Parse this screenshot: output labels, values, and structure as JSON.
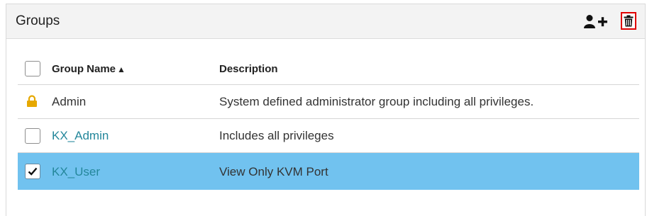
{
  "panel": {
    "title": "Groups",
    "toolbar": {
      "add_icon": "add-user-icon",
      "delete_icon": "trash-icon"
    }
  },
  "table": {
    "columns": {
      "name_header": "Group Name",
      "sort_indicator": "▲",
      "description_header": "Description"
    },
    "rows": [
      {
        "name": "Admin",
        "description": "System defined administrator group including all privileges.",
        "locked": true,
        "checked": false
      },
      {
        "name": "KX_Admin",
        "description": "Includes all privileges",
        "locked": false,
        "checked": false
      },
      {
        "name": "KX_User",
        "description": "View Only KVM Port",
        "locked": false,
        "checked": true
      }
    ]
  },
  "colors": {
    "selected_row": "#71c2ef",
    "link": "#24879b",
    "lock": "#e6a800",
    "delete_highlight": "#e00000"
  }
}
